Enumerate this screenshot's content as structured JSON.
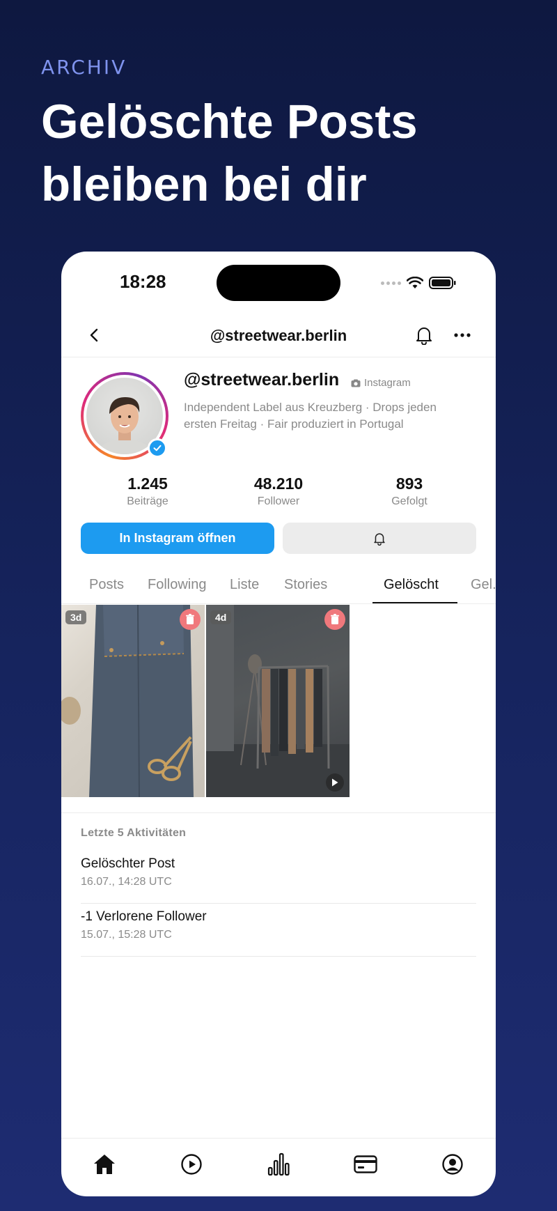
{
  "promo": {
    "eyebrow": "ARCHIV",
    "headline_line1": "Gelöschte Posts",
    "headline_line2": "bleiben bei dir"
  },
  "status_bar": {
    "time": "18:28"
  },
  "nav": {
    "title": "@streetwear.berlin"
  },
  "profile": {
    "handle": "@streetwear.berlin",
    "platform": "Instagram",
    "bio_line1": "Independent Label aus Kreuzberg · Drops jeden",
    "bio_line2": "ersten Freitag · Fair produziert in Portugal",
    "stats": [
      {
        "value": "1.245",
        "label": "Beiträge"
      },
      {
        "value": "48.210",
        "label": "Follower"
      },
      {
        "value": "893",
        "label": "Gefolgt"
      }
    ],
    "open_button": "In Instagram öffnen"
  },
  "tabs": [
    {
      "label": "Posts"
    },
    {
      "label": "Following"
    },
    {
      "label": "Liste"
    },
    {
      "label": "Stories"
    },
    {
      "label": "Gelöscht",
      "active": true
    },
    {
      "label": "Gel..."
    }
  ],
  "posts": [
    {
      "age": "3d",
      "kind": "image"
    },
    {
      "age": "4d",
      "kind": "video"
    }
  ],
  "activity": {
    "heading": "Letzte 5 Aktivitäten",
    "items": [
      {
        "title": "Gelöschter Post",
        "date": "16.07., 14:28 UTC"
      },
      {
        "title": "-1 Verlorene Follower",
        "date": "15.07., 15:28 UTC"
      }
    ]
  },
  "bottom_nav": [
    {
      "icon": "home-icon"
    },
    {
      "icon": "play-icon"
    },
    {
      "icon": "chart-icon"
    },
    {
      "icon": "card-icon"
    },
    {
      "icon": "profile-icon"
    }
  ],
  "colors": {
    "accent": "#1d9bf0",
    "delete": "#f0787c",
    "eyebrow": "#7f93ee"
  }
}
